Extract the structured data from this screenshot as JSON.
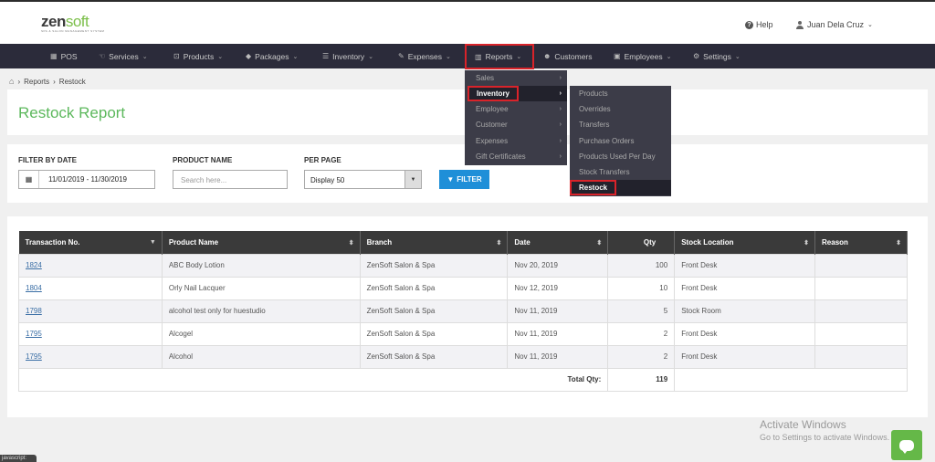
{
  "brand": {
    "name_part1": "zen",
    "name_part2": "soft",
    "tagline": "SPA & SALON MANAGEMENT SYSTEM"
  },
  "header": {
    "help_label": "Help",
    "user_name": "Juan Dela Cruz"
  },
  "nav": {
    "items": [
      {
        "label": "POS",
        "icon": "grid-icon"
      },
      {
        "label": "Services",
        "icon": "hand-icon"
      },
      {
        "label": "Products",
        "icon": "cart-icon"
      },
      {
        "label": "Packages",
        "icon": "tags-icon"
      },
      {
        "label": "Inventory",
        "icon": "list-icon"
      },
      {
        "label": "Expenses",
        "icon": "edit-icon"
      },
      {
        "label": "Reports",
        "icon": "bar-chart-icon"
      },
      {
        "label": "Customers",
        "icon": "users-icon"
      },
      {
        "label": "Employees",
        "icon": "briefcase-icon"
      },
      {
        "label": "Settings",
        "icon": "gear-icon"
      }
    ]
  },
  "breadcrumb": {
    "items": [
      "Reports",
      "Restock"
    ]
  },
  "page": {
    "title": "Restock Report"
  },
  "filters": {
    "date_label": "FILTER BY DATE",
    "date_value": "11/01/2019 - 11/30/2019",
    "product_label": "PRODUCT NAME",
    "product_placeholder": "Search here...",
    "per_page_label": "PER PAGE",
    "per_page_value": "Display 50",
    "filter_button": "FILTER"
  },
  "table": {
    "columns": [
      "Transaction No.",
      "Product Name",
      "Branch",
      "Date",
      "Qty",
      "Stock Location",
      "Reason"
    ],
    "rows": [
      [
        "1824",
        "ABC Body Lotion",
        "ZenSoft Salon & Spa",
        "Nov 20, 2019",
        "100",
        "Front Desk",
        ""
      ],
      [
        "1804",
        "Orly Nail Lacquer",
        "ZenSoft Salon & Spa",
        "Nov 12, 2019",
        "10",
        "Front Desk",
        ""
      ],
      [
        "1798",
        "alcohol test only for huestudio",
        "ZenSoft Salon & Spa",
        "Nov 11, 2019",
        "5",
        "Stock Room",
        ""
      ],
      [
        "1795",
        "Alcogel",
        "ZenSoft Salon & Spa",
        "Nov 11, 2019",
        "2",
        "Front Desk",
        ""
      ],
      [
        "1795",
        "Alcohol",
        "ZenSoft Salon & Spa",
        "Nov 11, 2019",
        "2",
        "Front Desk",
        ""
      ]
    ],
    "total_label": "Total Qty:",
    "total_value": "119"
  },
  "reports_menu": {
    "items": [
      "Sales",
      "Inventory",
      "Employee",
      "Customer",
      "Expenses",
      "Gift Certificates"
    ],
    "active": "Inventory"
  },
  "inventory_submenu": {
    "items": [
      "Products",
      "Overrides",
      "Transfers",
      "Purchase Orders",
      "Products Used Per Day",
      "Stock Transfers",
      "Restock"
    ],
    "active": "Restock"
  },
  "watermark": {
    "line1": "Activate Windows",
    "line2": "Go to Settings to activate Windows."
  },
  "status": {
    "text": "javascript:"
  }
}
